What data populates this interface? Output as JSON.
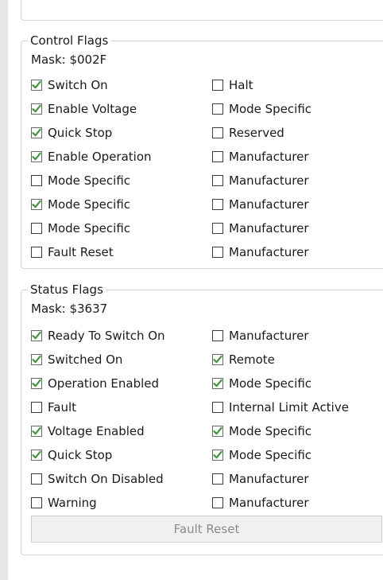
{
  "control_flags": {
    "title": "Control Flags",
    "mask": "Mask: $002F",
    "left": [
      {
        "label": "Switch On",
        "checked": true
      },
      {
        "label": "Enable Voltage",
        "checked": true
      },
      {
        "label": "Quick Stop",
        "checked": true
      },
      {
        "label": "Enable Operation",
        "checked": true
      },
      {
        "label": "Mode Specific",
        "checked": false
      },
      {
        "label": "Mode Specific",
        "checked": true
      },
      {
        "label": "Mode Specific",
        "checked": false
      },
      {
        "label": "Fault Reset",
        "checked": false
      }
    ],
    "right": [
      {
        "label": "Halt",
        "checked": false
      },
      {
        "label": "Mode Specific",
        "checked": false
      },
      {
        "label": "Reserved",
        "checked": false
      },
      {
        "label": "Manufacturer",
        "checked": false
      },
      {
        "label": "Manufacturer",
        "checked": false
      },
      {
        "label": "Manufacturer",
        "checked": false
      },
      {
        "label": "Manufacturer",
        "checked": false
      },
      {
        "label": "Manufacturer",
        "checked": false
      }
    ]
  },
  "status_flags": {
    "title": "Status Flags",
    "mask": "Mask: $3637",
    "left": [
      {
        "label": "Ready To Switch On",
        "checked": true
      },
      {
        "label": "Switched On",
        "checked": true
      },
      {
        "label": "Operation Enabled",
        "checked": true
      },
      {
        "label": "Fault",
        "checked": false
      },
      {
        "label": "Voltage Enabled",
        "checked": true
      },
      {
        "label": "Quick Stop",
        "checked": true
      },
      {
        "label": "Switch On Disabled",
        "checked": false
      },
      {
        "label": "Warning",
        "checked": false
      }
    ],
    "right": [
      {
        "label": "Manufacturer",
        "checked": false
      },
      {
        "label": "Remote",
        "checked": true
      },
      {
        "label": "Mode Specific",
        "checked": true
      },
      {
        "label": "Internal Limit Active",
        "checked": false
      },
      {
        "label": "Mode Specific",
        "checked": true
      },
      {
        "label": "Mode Specific",
        "checked": true
      },
      {
        "label": "Manufacturer",
        "checked": false
      },
      {
        "label": "Manufacturer",
        "checked": false
      }
    ],
    "fault_reset_label": "Fault Reset"
  },
  "colors": {
    "check_mark": "#3c9a3c",
    "border": "#d4d4d4",
    "disabled_text": "#8c8c8c"
  }
}
